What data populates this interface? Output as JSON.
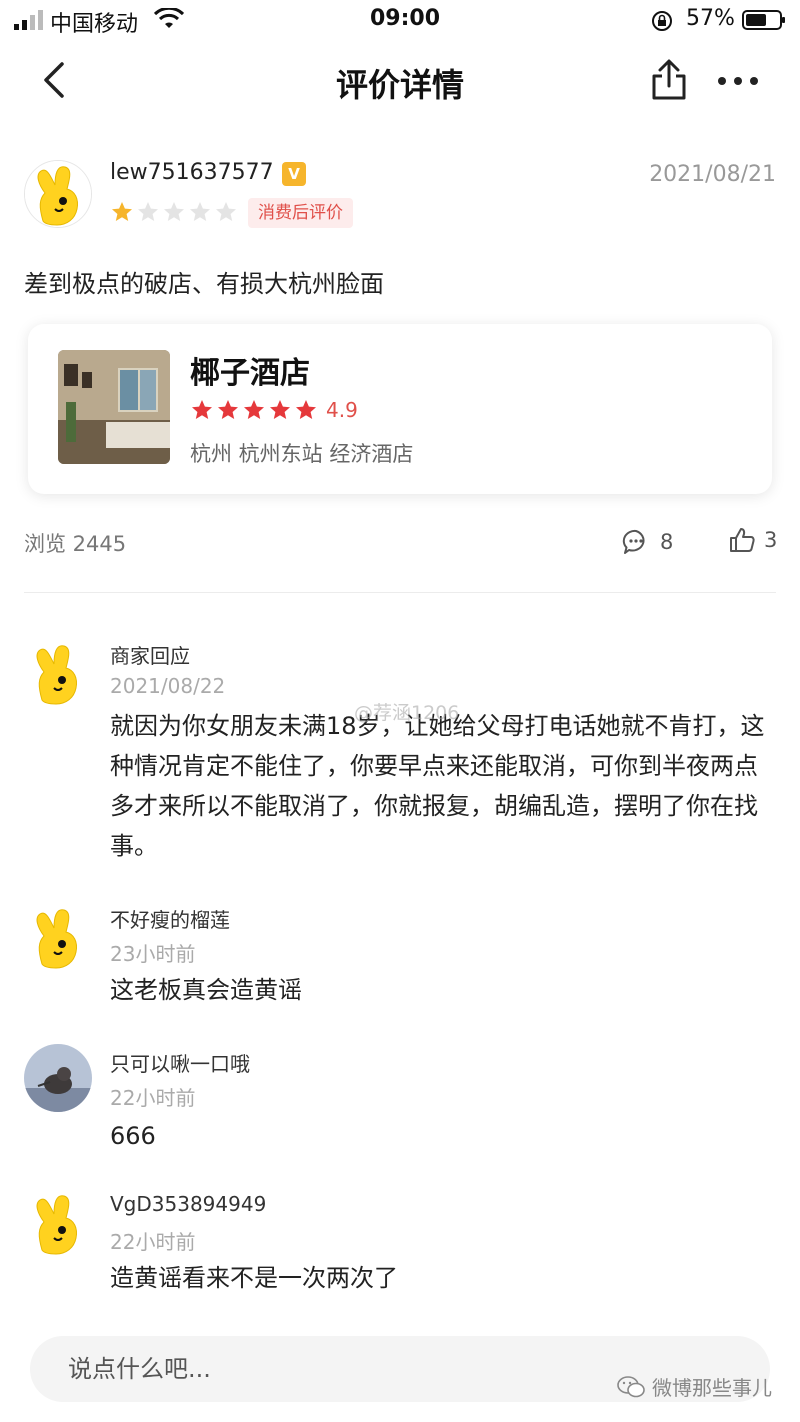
{
  "status_bar": {
    "carrier": "中国移动",
    "time": "09:00",
    "battery_percent": "57%"
  },
  "nav": {
    "title": "评价详情"
  },
  "review": {
    "author": "lew751637577",
    "vip_badge": "V",
    "date": "2021/08/21",
    "rating": 1,
    "rating_max": 5,
    "tag": "消费后评价",
    "text": "差到极点的破店、有损大杭州脸面"
  },
  "hotel": {
    "name": "椰子酒店",
    "rating": 5,
    "score": "4.9",
    "location": "杭州 杭州东站 经济酒店"
  },
  "stats": {
    "views": "浏览 2445",
    "comments": "8",
    "likes": "3"
  },
  "comments": [
    {
      "name": "商家回应",
      "time": "2021/08/22",
      "text": "就因为你女朋友未满18岁，让她给父母打电话她就不肯打，这种情况肯定不能住了，你要早点来还能取消，可你到半夜两点多才来所以不能取消了，你就报复，胡编乱造，摆明了你在找事。"
    },
    {
      "name": "不好瘦的榴莲",
      "time": "23小时前",
      "text": "这老板真会造黄谣"
    },
    {
      "name": "只可以啾一口哦",
      "time": "22小时前",
      "text": "666"
    },
    {
      "name": "VgD353894949",
      "time": "22小时前",
      "text": "造黄谣看来不是一次两次了"
    }
  ],
  "input": {
    "placeholder": "说点什么吧..."
  },
  "watermarks": {
    "middle": "@荐涵1206",
    "bottom_right": "微博那些事儿"
  },
  "colors": {
    "accent_red": "#e0504a",
    "star_gold": "#f6b52c",
    "hotel_star": "#e5383b"
  }
}
